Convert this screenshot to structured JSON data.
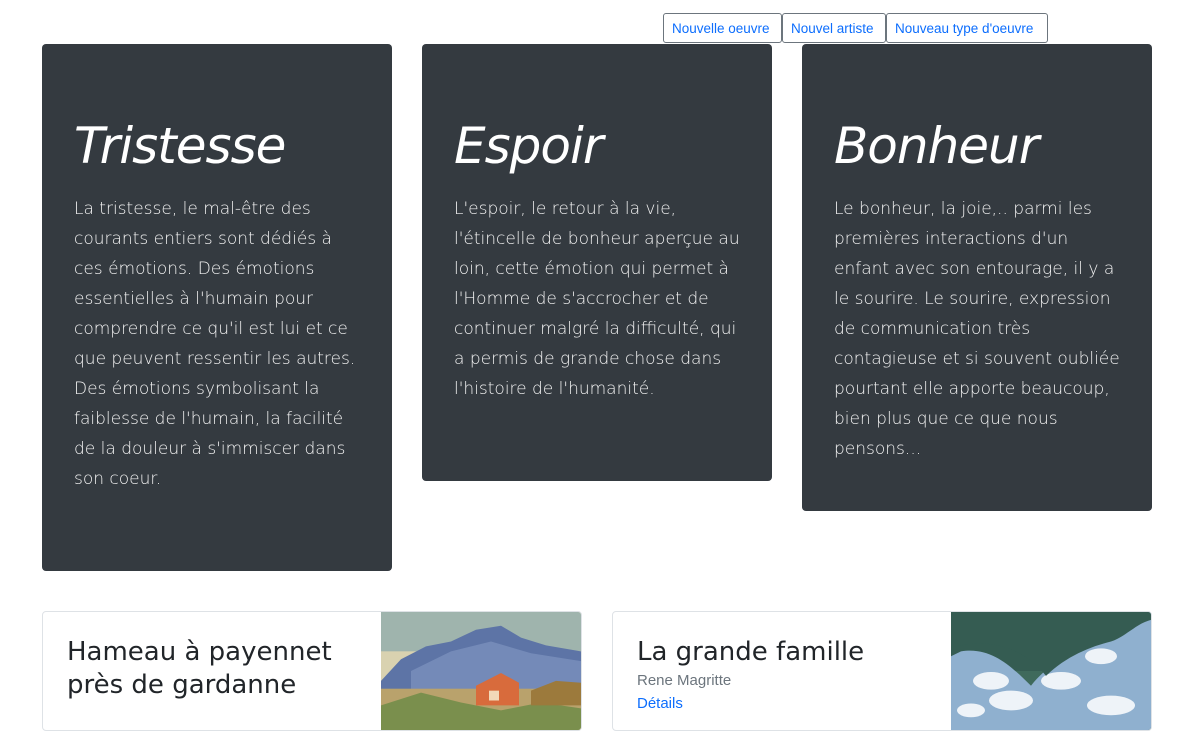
{
  "toolbar": {
    "new_artwork": "Nouvelle oeuvre",
    "new_artist": "Nouvel artiste",
    "new_artwork_type": "Nouveau type d'oeuvre"
  },
  "emotions": [
    {
      "title": "Tristesse",
      "text": "La tristesse, le mal-être des courants entiers sont dédiés à ces émotions. Des émotions essentielles à l'humain pour comprendre ce qu'il est lui et ce que peuvent ressentir les autres. Des émotions symbolisant la faiblesse de l'humain, la facilité de la douleur à s'immiscer dans son coeur."
    },
    {
      "title": "Espoir",
      "text": "L'espoir, le retour à la vie, l'étincelle de bonheur aperçue au loin, cette émotion qui permet à l'Homme de s'accrocher et de continuer malgré la difficulté, qui a permis de grande chose dans l'histoire de l'humanité."
    },
    {
      "title": "Bonheur",
      "text": "Le bonheur, la joie,.. parmi les premières interactions d'un enfant avec son entourage, il y a le sourire. Le sourire, expression de communication très contagieuse et si souvent oubliée pourtant elle apporte beaucoup, bien plus que ce que nous pensons..."
    }
  ],
  "artworks": [
    {
      "title": "Hameau à payennet près de gardanne",
      "artist": "",
      "link": ""
    },
    {
      "title": "La grande famille",
      "artist": "Rene Magritte",
      "link": "Détails"
    }
  ]
}
